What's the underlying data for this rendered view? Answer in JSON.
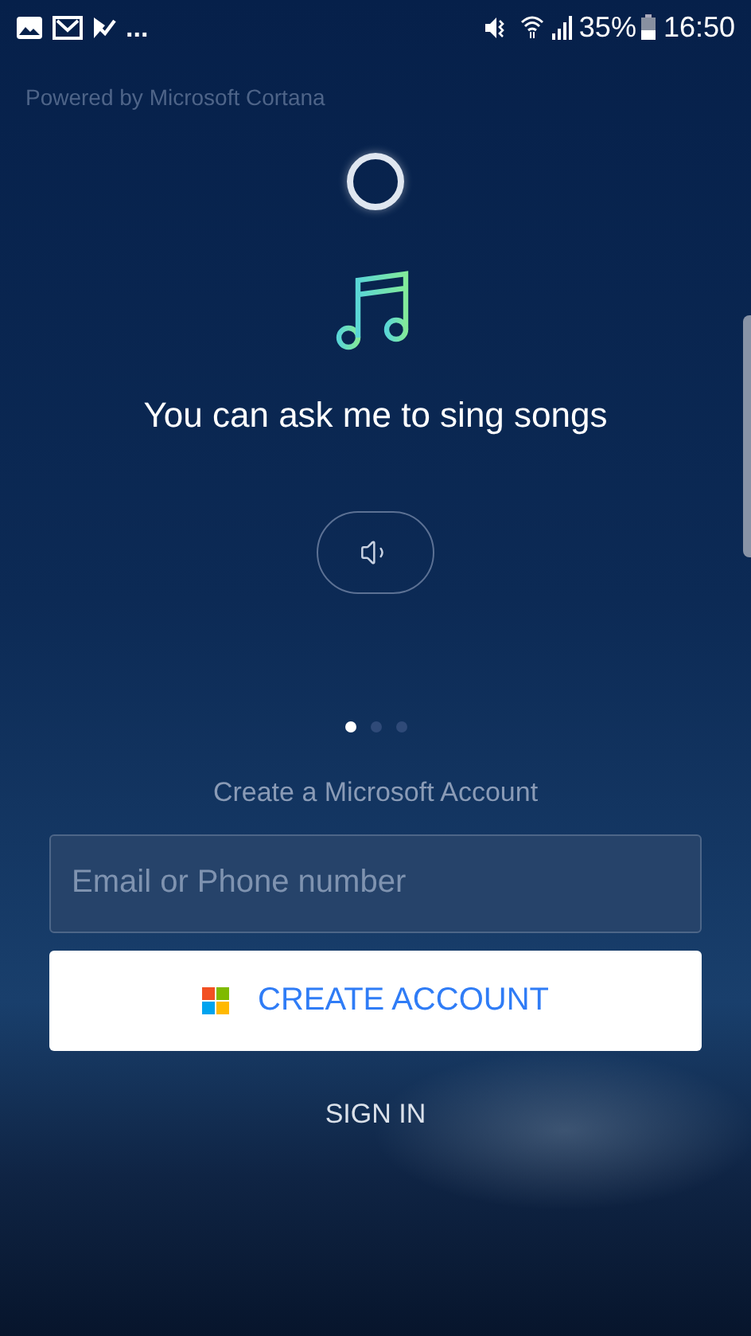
{
  "status_bar": {
    "more": "...",
    "battery": "35%",
    "time": "16:50"
  },
  "powered_by": "Powered by Microsoft Cortana",
  "slide": {
    "caption": "You can ask me to sing songs"
  },
  "pager": [
    {
      "selected": true
    },
    {
      "selected": false
    },
    {
      "selected": false
    }
  ],
  "account": {
    "heading": "Create a Microsoft Account",
    "email": {
      "placeholder": "Email or Phone number"
    },
    "create_button": "CREATE ACCOUNT",
    "sign_in": "SIGN IN"
  }
}
